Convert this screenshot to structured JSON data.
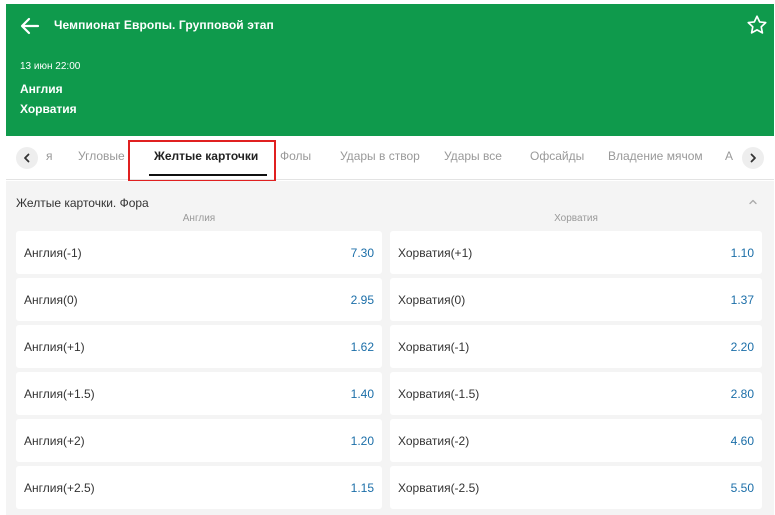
{
  "header": {
    "title": "Чемпионат Европы. Групповой этап",
    "match_time": "13 июн 22:00",
    "team1": "Англия",
    "team2": "Хорватия",
    "background_color": "#0f9a4c"
  },
  "tabs": [
    {
      "label": "я"
    },
    {
      "label": "Угловые"
    },
    {
      "label": "Желтые карточки",
      "active": true
    },
    {
      "label": "Фолы"
    },
    {
      "label": "Удары в створ"
    },
    {
      "label": "Удары все"
    },
    {
      "label": "Офсайды"
    },
    {
      "label": "Владение мячом"
    },
    {
      "label": "А"
    }
  ],
  "market": {
    "title": "Желтые карточки. Фора",
    "col_left": "Англия",
    "col_right": "Хорватия",
    "rows": [
      {
        "left_label": "Англия(-1)",
        "left_odds": "7.30",
        "right_label": "Хорватия(+1)",
        "right_odds": "1.10"
      },
      {
        "left_label": "Англия(0)",
        "left_odds": "2.95",
        "right_label": "Хорватия(0)",
        "right_odds": "1.37"
      },
      {
        "left_label": "Англия(+1)",
        "left_odds": "1.62",
        "right_label": "Хорватия(-1)",
        "right_odds": "2.20"
      },
      {
        "left_label": "Англия(+1.5)",
        "left_odds": "1.40",
        "right_label": "Хорватия(-1.5)",
        "right_odds": "2.80"
      },
      {
        "left_label": "Англия(+2)",
        "left_odds": "1.20",
        "right_label": "Хорватия(-2)",
        "right_odds": "4.60"
      },
      {
        "left_label": "Англия(+2.5)",
        "left_odds": "1.15",
        "right_label": "Хорватия(-2.5)",
        "right_odds": "5.50"
      }
    ]
  },
  "colors": {
    "brand_green": "#0f9a4c",
    "odds_blue": "#1b6ea8",
    "highlight_red": "#e02020"
  },
  "icons": [
    "arrow-left-icon",
    "star-icon",
    "chevron-left-icon",
    "chevron-right-icon",
    "chevron-up-icon"
  ]
}
